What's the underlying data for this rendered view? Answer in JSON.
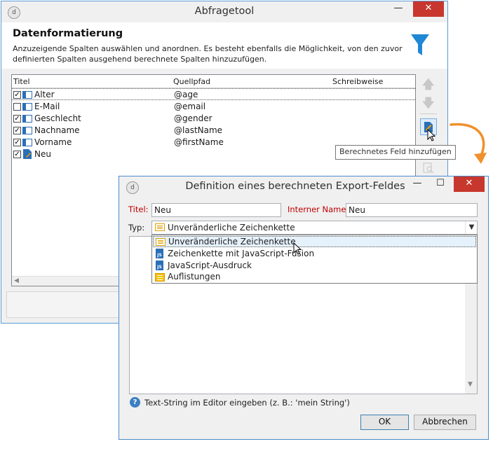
{
  "main_window": {
    "title": "Abfragetool",
    "heading": "Datenformatierung",
    "description_line1": "Anzuzeigende Spalten auswählen und anordnen. Es besteht ebenfalls die Möglichkeit, von den zuvor",
    "description_line2": "definierten Spalten ausgehend berechnete Spalten hinzuzufügen.",
    "columns": [
      "Titel",
      "Quellpfad",
      "Schreibweise"
    ],
    "rows": [
      {
        "title": "Alter",
        "path": "@age",
        "checked": true,
        "icon": "column-icon"
      },
      {
        "title": "E-Mail",
        "path": "@email",
        "checked": false,
        "icon": "column-icon"
      },
      {
        "title": "Geschlecht",
        "path": "@gender",
        "checked": true,
        "icon": "column-icon"
      },
      {
        "title": "Nachname",
        "path": "@lastName",
        "checked": true,
        "icon": "column-icon"
      },
      {
        "title": "Vorname",
        "path": "@firstName",
        "checked": true,
        "icon": "column-icon"
      },
      {
        "title": "Neu",
        "path": "",
        "checked": true,
        "icon": "calculated-field-icon"
      }
    ],
    "tooltip": "Berechnetes Feld hinzufügen",
    "minimize_glyph": "—",
    "close_glyph": "✕"
  },
  "dialog": {
    "title": "Definition eines berechneten Export-Feldes",
    "titel_label": "Titel:",
    "titel_value": "Neu",
    "internal_name_label": "Interner Name:",
    "internal_name_value": "Neu",
    "typ_label": "Typ:",
    "typ_value": "Unveränderliche Zeichenkette",
    "dropdown_options": [
      {
        "label": "Unveränderliche Zeichenkette",
        "icon": "string-icon",
        "highlighted": true
      },
      {
        "label": "Zeichenkette mit JavaScript-Fusion",
        "icon": "js-icon",
        "highlighted": false
      },
      {
        "label": "JavaScript-Ausdruck",
        "icon": "js-icon",
        "highlighted": false
      },
      {
        "label": "Auflistungen",
        "icon": "list-icon",
        "highlighted": false
      }
    ],
    "help_text": "Text-String im Editor eingeben (z. B.: 'mein String')",
    "ok_label": "OK",
    "cancel_label": "Abbrechen",
    "minimize_glyph": "—",
    "maximize_glyph": "☐",
    "close_glyph": "✕"
  },
  "colors": {
    "accent": "#5b9bd5",
    "close": "#c7372d",
    "label_red": "#c00000",
    "arrow_orange": "#f0902c",
    "highlight": "#e5f1fb",
    "filter_blue": "#1e88d4"
  }
}
